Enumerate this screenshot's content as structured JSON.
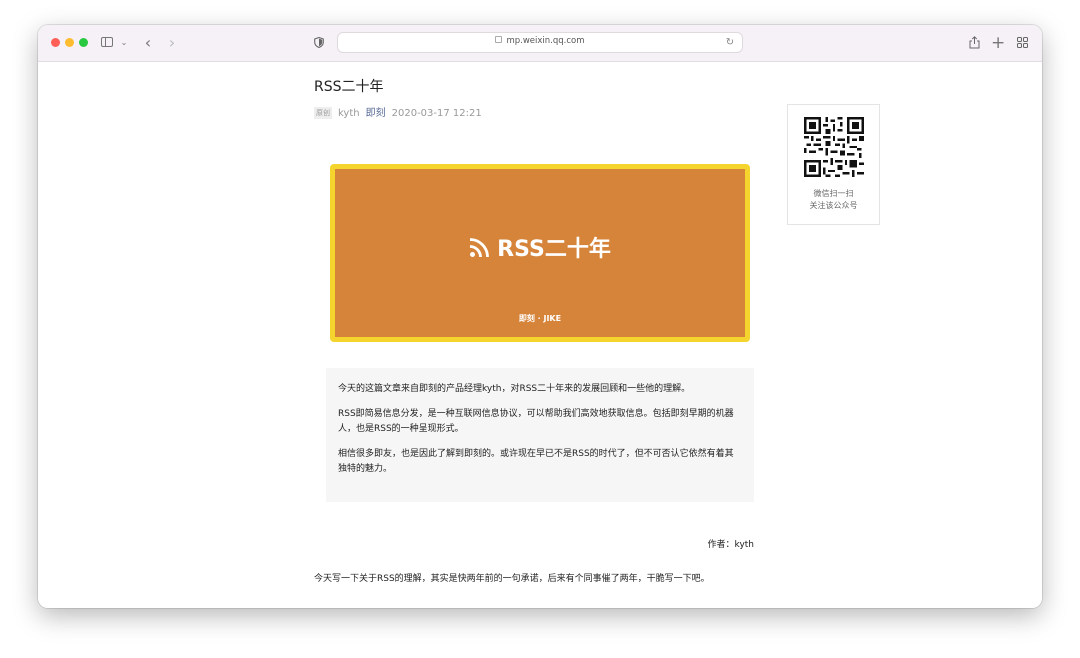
{
  "browser": {
    "url": "mp.weixin.qq.com",
    "colors": {
      "close": "#fe5f57",
      "minimize": "#febc2e",
      "zoom": "#28c840",
      "toolbar_bg": "#f6f1f7"
    },
    "toolbar_icons": [
      "sidebar-icon",
      "chevron-down-icon",
      "back-icon",
      "forward-icon",
      "shield-icon",
      "reload-icon",
      "share-icon",
      "new-tab-icon",
      "tab-overview-icon"
    ]
  },
  "article": {
    "title": "RSS二十年",
    "tag": "原创",
    "author": "kyth",
    "account": "即刻",
    "datetime": "2020-03-17 12:21",
    "banner": {
      "title": "RSS二十年",
      "brand": "即刻 · JIKE",
      "colors": {
        "border": "#f5d42e",
        "fill": "#d6843a"
      }
    },
    "intro": [
      "今天的这篇文章来自即刻的产品经理kyth，对RSS二十年来的发展回顾和一些他的理解。",
      "RSS即简易信息分发，是一种互联网信息协议，可以帮助我们高效地获取信息。包括即刻早期的机器人，也是RSS的一种呈现形式。",
      "相信很多即友，也是因此了解到即刻的。或许现在早已不是RSS的时代了，但不可否认它依然有着其独特的魅力。"
    ],
    "byline": "作者：kyth",
    "body": "今天写一下关于RSS的理解，其实是快两年前的一句承诺，后来有个同事催了两年，干脆写一下吧。"
  },
  "qr": {
    "line1": "微信扫一扫",
    "line2": "关注该公众号"
  }
}
